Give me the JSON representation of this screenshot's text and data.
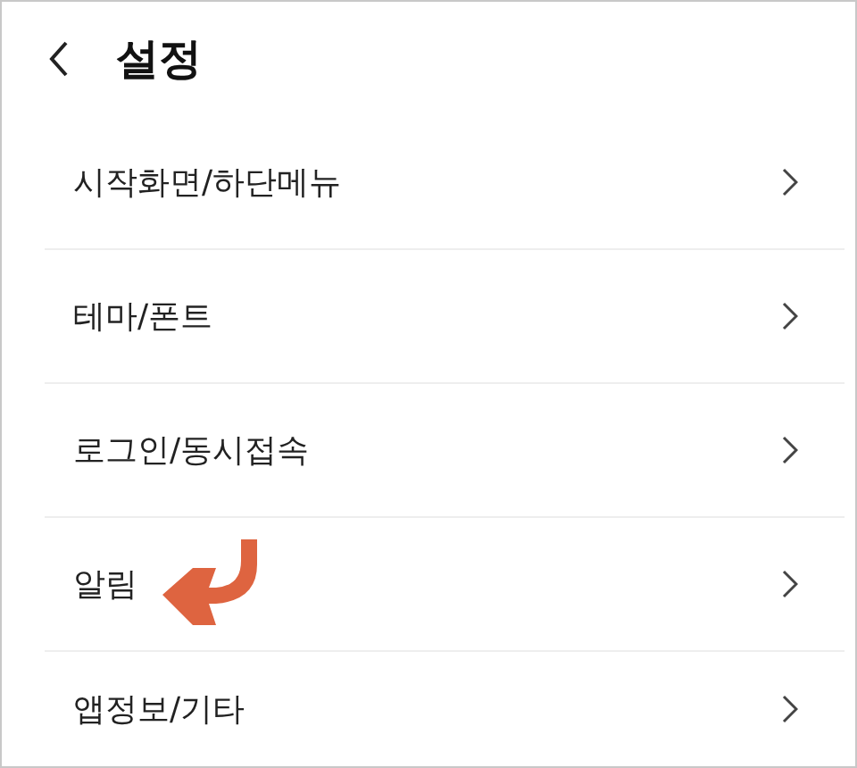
{
  "header": {
    "title": "설정"
  },
  "items": [
    {
      "label": "시작화면/하단메뉴",
      "pointer_arrow": false
    },
    {
      "label": "테마/폰트",
      "pointer_arrow": false
    },
    {
      "label": "로그인/동시접속",
      "pointer_arrow": false
    },
    {
      "label": "알림",
      "pointer_arrow": true
    },
    {
      "label": "앱정보/기타",
      "pointer_arrow": false
    }
  ]
}
